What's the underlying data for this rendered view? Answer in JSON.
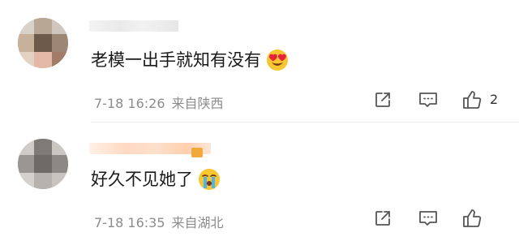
{
  "comments": [
    {
      "text": "老模一出手就知有没有",
      "emoji": "heart-eyes-emoji",
      "date": "7-18 16:26",
      "location": "来自陕西",
      "like_count": "2"
    },
    {
      "text": "好久不见她了",
      "emoji": "crying-emoji",
      "date": "7-18 16:35",
      "location": "来自湖北",
      "like_count": ""
    }
  ],
  "icons": {
    "share": "share-icon",
    "comment": "comment-icon",
    "like": "thumbs-up-icon"
  },
  "colors": {
    "text": "#1a1a1a",
    "meta": "#8c8c8c",
    "icon": "#555555",
    "divider": "#ececec"
  }
}
